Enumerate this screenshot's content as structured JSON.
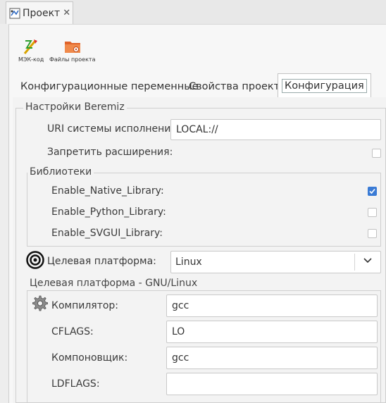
{
  "doc_tab": {
    "title": "Проект",
    "close": "✕"
  },
  "toolbar": {
    "iec_code_label": "МЭК-код",
    "project_files_label": "Файлы проекта"
  },
  "tabs": [
    {
      "label": "Конфигурационные переменные"
    },
    {
      "label": "Свойства проекта"
    },
    {
      "label": "Конфигурация"
    }
  ],
  "beremiz": {
    "title": "Настройки Beremiz",
    "uri_label": "URI системы исполнения:",
    "uri_value": "LOCAL://",
    "disable_ext_label": "Запретить расширения:",
    "disable_ext_checked": false
  },
  "libraries": {
    "title": "Библиотеки",
    "items": [
      {
        "label": "Enable_Native_Library:",
        "checked": true
      },
      {
        "label": "Enable_Python_Library:",
        "checked": false
      },
      {
        "label": "Enable_SVGUI_Library:",
        "checked": false
      }
    ]
  },
  "target": {
    "label": "Целевая платформа:",
    "value": "Linux"
  },
  "gnu": {
    "title": "Целевая платформа - GNU/Linux",
    "compiler_label": "Компилятор:",
    "compiler_value": "gcc",
    "cflags_label": "CFLAGS:",
    "cflags_value": "LO",
    "linker_label": "Компоновщик:",
    "linker_value": "gcc",
    "ldflags_label": "LDFLAGS:",
    "ldflags_value": ""
  },
  "colors": {
    "accent": "#3a7bd5"
  }
}
